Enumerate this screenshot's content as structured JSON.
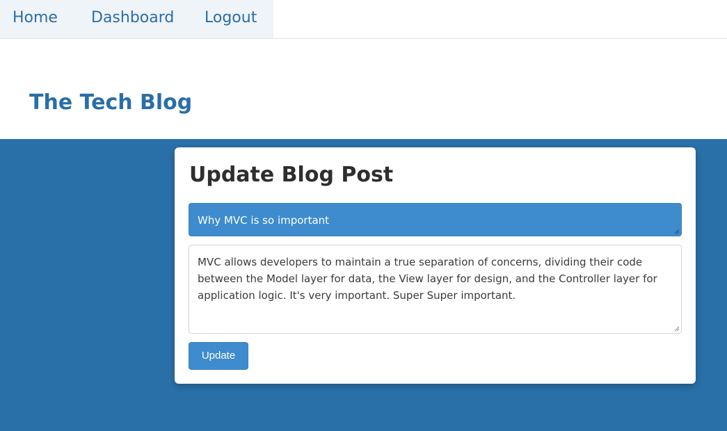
{
  "nav": {
    "home": "Home",
    "dashboard": "Dashboard",
    "logout": "Logout"
  },
  "brand": "The Tech Blog",
  "form": {
    "heading": "Update Blog Post",
    "title_value": "Why MVC is so important",
    "body_value": "MVC allows developers to maintain a true separation of concerns, dividing their code between the Model layer for data, the View layer for design, and the Controller layer for application logic. It's very important. Super Super important.",
    "update_label": "Update"
  },
  "colors": {
    "accent": "#3e8ccd",
    "brand_blue": "#2a6ea7",
    "background_blue": "#2a70a8"
  }
}
